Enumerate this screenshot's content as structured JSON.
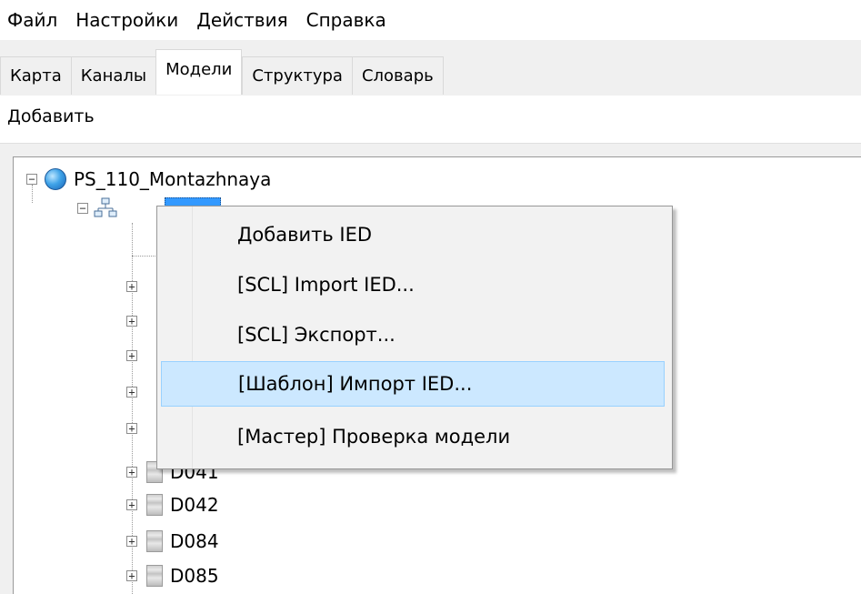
{
  "menu": [
    "Файл",
    "Настройки",
    "Действия",
    "Справка"
  ],
  "tabs": [
    {
      "label": "Карта",
      "active": false
    },
    {
      "label": "Каналы",
      "active": false
    },
    {
      "label": "Модели",
      "active": true
    },
    {
      "label": "Структура",
      "active": false
    },
    {
      "label": "Словарь",
      "active": false
    }
  ],
  "toolbar": {
    "add_label": "Добавить"
  },
  "tree": {
    "root": {
      "label": "PS_110_Montazhnaya",
      "icon": "globe-icon"
    },
    "child": {
      "label": "",
      "icon": "network-icon",
      "selected": true
    },
    "visible_ieds": [
      "D041",
      "D042",
      "D084",
      "D085"
    ]
  },
  "context_menu": {
    "items": [
      {
        "label": "Добавить IED"
      },
      {
        "label": "[SCL] Import IED..."
      },
      {
        "label": "[SCL] Экспорт..."
      },
      {
        "label": "[Шаблон] Импорт IED...",
        "highlighted": true
      },
      {
        "label": "[Мастер] Проверка модели"
      }
    ],
    "highlight_color": "#cce8ff"
  }
}
